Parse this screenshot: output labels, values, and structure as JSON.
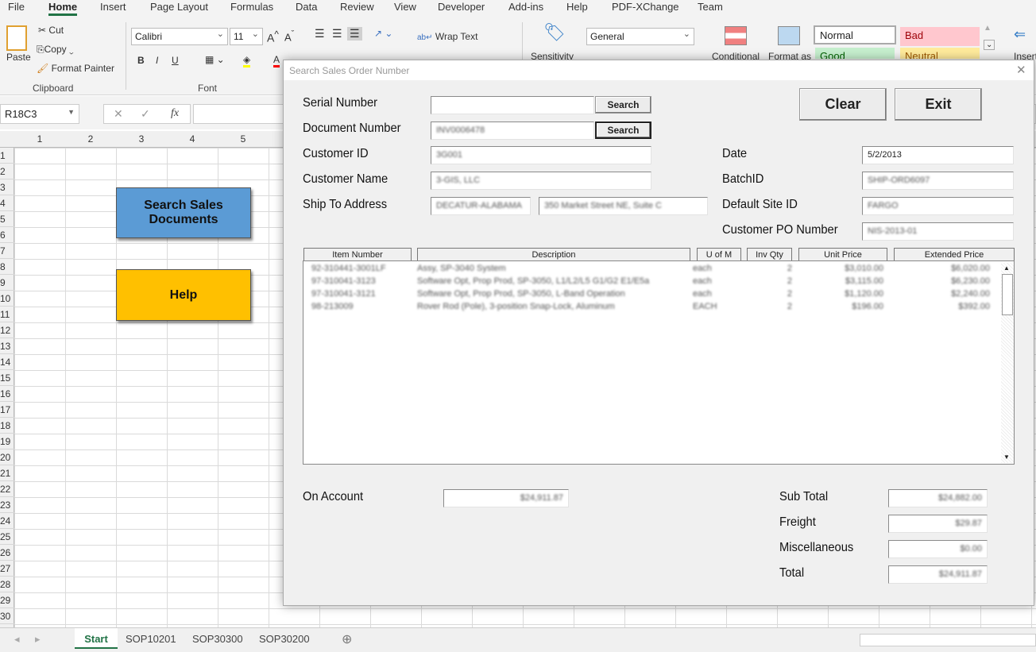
{
  "menu": {
    "tabs": [
      "File",
      "Home",
      "Insert",
      "Page Layout",
      "Formulas",
      "Data",
      "Review",
      "View",
      "Developer",
      "Add-ins",
      "Help",
      "PDF-XChange",
      "Team"
    ],
    "active": "Home"
  },
  "ribbon": {
    "clipboard": {
      "paste": "Paste",
      "cut": "Cut",
      "copy": "Copy",
      "format_painter": "Format Painter",
      "group": "Clipboard"
    },
    "font": {
      "name": "Calibri",
      "size": "11",
      "group": "Font",
      "bold": "B",
      "italic": "I",
      "underline": "U"
    },
    "alignment": {
      "wrap_text": "Wrap Text"
    },
    "sensitivity": "Sensitivity",
    "number": {
      "format": "General"
    },
    "conditional": "Conditional",
    "format_as": "Format as",
    "styles": {
      "normal": "Normal",
      "bad": "Bad",
      "good": "Good",
      "neutral": "Neutral"
    },
    "insert": "Insert",
    "colors": {
      "underline_highlight": "#ffff00",
      "font_color": "#ff0000",
      "bad_bg": "#ffc7ce",
      "good_bg": "#c6efce",
      "neutral_bg": "#ffeb9c"
    }
  },
  "formula_bar": {
    "name_box": "R18C3",
    "fx": "fx",
    "value": ""
  },
  "sheet": {
    "columns": [
      "1",
      "2",
      "3",
      "4",
      "5"
    ],
    "rows": [
      "1",
      "2",
      "3",
      "4",
      "5",
      "6",
      "7",
      "8",
      "9",
      "10",
      "11",
      "12",
      "13",
      "14",
      "15",
      "16",
      "17",
      "18",
      "19",
      "20",
      "21",
      "22",
      "23",
      "24",
      "25",
      "26",
      "27",
      "28",
      "29",
      "30"
    ],
    "buttons": {
      "search": "Search Sales Documents",
      "help": "Help",
      "search_color": "#5b9bd5",
      "help_color": "#ffc000"
    }
  },
  "sheet_tabs": {
    "tabs": [
      "Start",
      "SOP10201",
      "SOP30300",
      "SOP30200"
    ],
    "active": "Start"
  },
  "dialog": {
    "title": "Search Sales Order Number",
    "labels": {
      "serial": "Serial Number",
      "document": "Document Number",
      "customer_id": "Customer ID",
      "customer_name": "Customer Name",
      "ship_to": "Ship To Address",
      "date": "Date",
      "batch": "BatchID",
      "site": "Default Site ID",
      "po": "Customer PO Number",
      "on_account": "On Account",
      "sub_total": "Sub Total",
      "freight": "Freight",
      "misc": "Miscellaneous",
      "total": "Total"
    },
    "values": {
      "serial": "",
      "document": "INV0006478",
      "customer_id": "3G001",
      "customer_name": "3-GIS, LLC",
      "ship_to_1": "DECATUR-ALABAMA",
      "ship_to_2": "350 Market Street NE, Suite C",
      "date": "5/2/2013",
      "batch": "SHIP-ORD6097",
      "site": "FARGO",
      "po": "NIS-2013-01",
      "on_account": "$24,911.87",
      "sub_total": "$24,882.00",
      "freight": "$29.87",
      "misc": "$0.00",
      "total": "$24,911.87"
    },
    "buttons": {
      "search": "Search",
      "clear": "Clear",
      "exit": "Exit"
    },
    "grid": {
      "headers": [
        "Item Number",
        "Description",
        "U of M",
        "Inv Qty",
        "Unit Price",
        "Extended Price"
      ],
      "rows": [
        [
          "92-310441-3001LF",
          "Assy, SP-3040 System",
          "each",
          "2",
          "$3,010.00",
          "$6,020.00"
        ],
        [
          "97-310041-3123",
          "Software Opt, Prop Prod, SP-3050, L1/L2/L5 G1/G2 E1/E5a",
          "each",
          "2",
          "$3,115.00",
          "$6,230.00"
        ],
        [
          "97-310041-3121",
          "Software Opt, Prop Prod, SP-3050, L-Band Operation",
          "each",
          "2",
          "$1,120.00",
          "$2,240.00"
        ],
        [
          "98-213009",
          "Rover Rod (Pole), 3-position Snap-Lock, Aluminum",
          "EACH",
          "2",
          "$196.00",
          "$392.00"
        ]
      ]
    }
  }
}
